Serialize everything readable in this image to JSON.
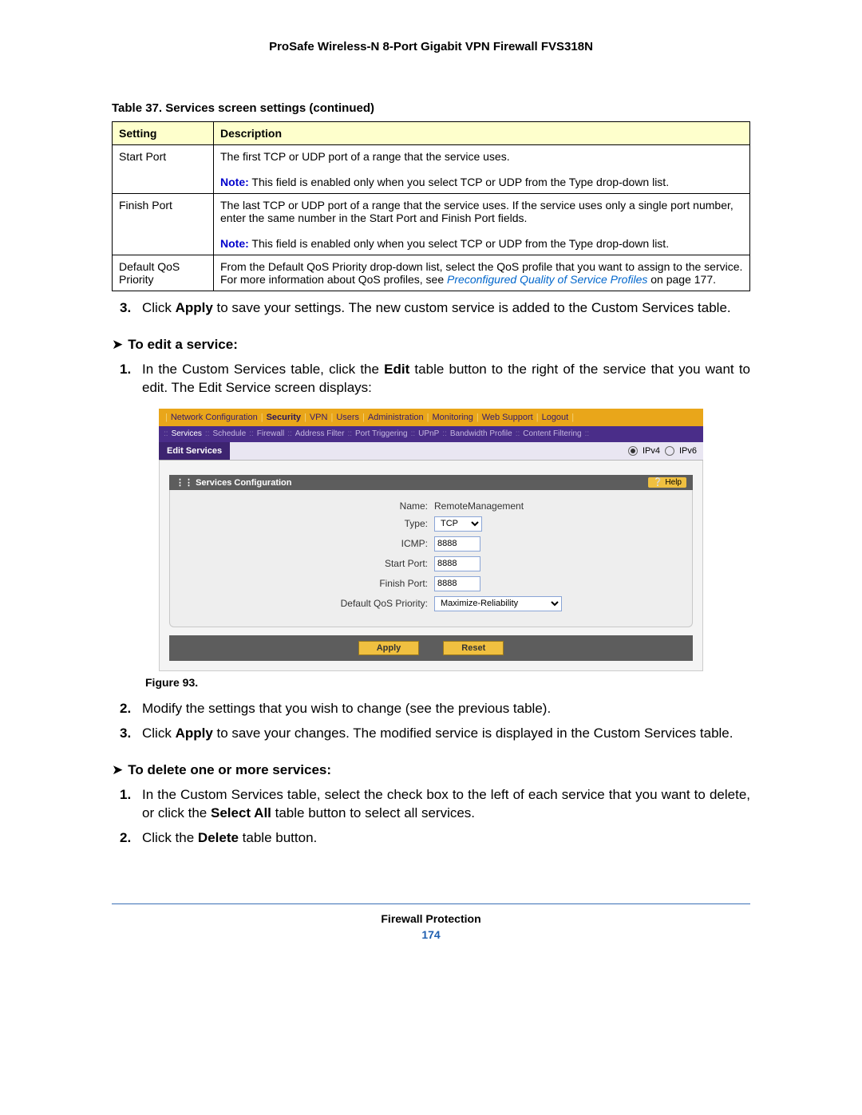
{
  "header": {
    "title": "ProSafe Wireless-N 8-Port Gigabit VPN Firewall FVS318N"
  },
  "table": {
    "caption": "Table 37.  Services screen settings (continued)",
    "headers": {
      "setting": "Setting",
      "description": "Description"
    },
    "rows": [
      {
        "setting": "Start Port",
        "desc": "The first TCP or UDP port of a range that the service uses.",
        "note_label": "Note:",
        "note_text": "  This field is enabled only when you select TCP or UDP from the Type drop-down list."
      },
      {
        "setting": "Finish Port",
        "desc": "The last TCP or UDP port of a range that the service uses. If the service uses only a single port number, enter the same number in the Start Port and Finish Port fields.",
        "note_label": "Note:",
        "note_text": "  This field is enabled only when you select TCP or UDP from the Type drop-down list."
      },
      {
        "setting": "Default QoS Priority",
        "desc_pre": "From the Default QoS Priority drop-down list, select the QoS profile that you want to assign to the service. For more information about QoS profiles, see ",
        "link": "Preconfigured Quality of Service Profiles",
        "desc_post": " on page 177."
      }
    ]
  },
  "step3": {
    "num": "3.",
    "pre": "Click ",
    "bold": "Apply",
    "post": " to save your settings. The new custom service is added to the Custom Services table."
  },
  "edit_section": {
    "arrow": "➤",
    "title": "To edit a service:",
    "step1": {
      "num": "1.",
      "pre": "In the Custom Services table, click the ",
      "bold": "Edit",
      "post": " table button to the right of the service that you want to edit. The Edit Service screen displays:"
    }
  },
  "ui": {
    "topnav": [
      "Network Configuration",
      "Security",
      "VPN",
      "Users",
      "Administration",
      "Monitoring",
      "Web Support",
      "Logout"
    ],
    "topnav_active_index": 1,
    "subnav": [
      "Services",
      "Schedule",
      "Firewall",
      "Address Filter",
      "Port Triggering",
      "UPnP",
      "Bandwidth Profile",
      "Content Filtering"
    ],
    "subnav_active_index": 0,
    "panel_title": "Edit Services",
    "ip_options": {
      "ipv4": "IPv4",
      "ipv6": "IPv6"
    },
    "section_title": "Services Configuration",
    "help_label": "Help",
    "form": {
      "name_label": "Name:",
      "name_value": "RemoteManagement",
      "type_label": "Type:",
      "type_value": "TCP",
      "icmp_label": "ICMP:",
      "icmp_value": "8888",
      "start_label": "Start Port:",
      "start_value": "8888",
      "finish_label": "Finish Port:",
      "finish_value": "8888",
      "qos_label": "Default QoS Priority:",
      "qos_value": "Maximize-Reliability"
    },
    "apply": "Apply",
    "reset": "Reset"
  },
  "figure_caption": "Figure 93.",
  "after_steps": {
    "s2": {
      "num": "2.",
      "text": "Modify the settings that you wish to change (see the previous table)."
    },
    "s3": {
      "num": "3.",
      "pre": "Click ",
      "bold": "Apply",
      "post": " to save your changes. The modified service is displayed in the Custom Services table."
    }
  },
  "delete_section": {
    "arrow": "➤",
    "title": "To delete one or more services:",
    "s1": {
      "num": "1.",
      "pre": "In the Custom Services table, select the check box to the left of each service that you want to delete, or click the ",
      "bold": "Select All",
      "post": " table button to select all services."
    },
    "s2": {
      "num": "2.",
      "pre": "Click the ",
      "bold": "Delete",
      "post": " table button."
    }
  },
  "footer": {
    "text": "Firewall Protection",
    "page": "174"
  }
}
